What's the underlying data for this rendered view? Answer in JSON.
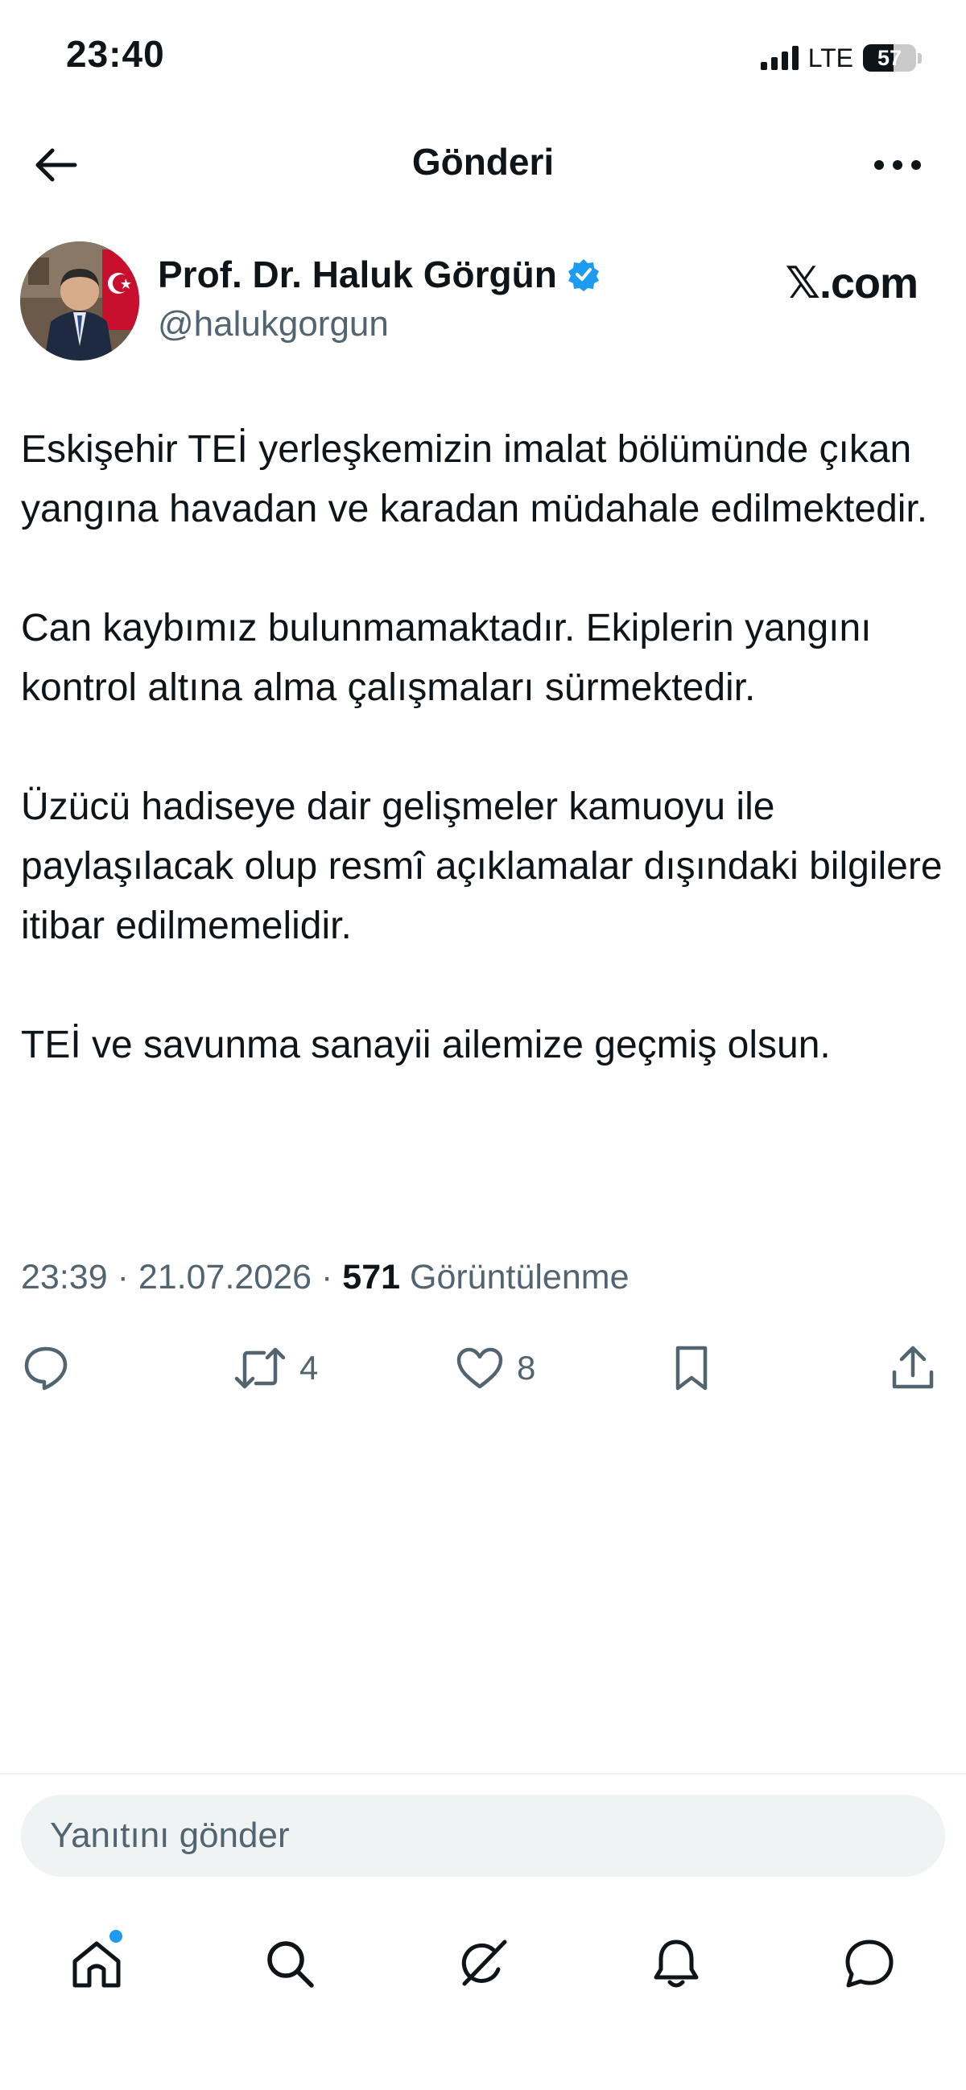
{
  "status_bar": {
    "time": "23:40",
    "network": "LTE",
    "battery": "57"
  },
  "header": {
    "title": "Gönderi"
  },
  "post": {
    "author_name": "Prof. Dr. Haluk Görgün",
    "author_handle": "@halukgorgun",
    "source": "𝕏.com",
    "paragraphs": [
      "Eskişehir TEİ yerleşkemizin imalat bölümünde çıkan yangına havadan ve karadan müdahale edilmektedir.",
      "Can kaybımız bulunmamaktadır. Ekiplerin yangını kontrol altına alma çalışmaları sürmektedir.",
      "Üzücü hadiseye dair gelişmeler kamuoyu ile paylaşılacak olup resmî açıklamalar dışındaki bilgilere itibar edilmemelidir.",
      "TEİ ve savunma sanayii ailemize geçmiş olsun."
    ],
    "time": "23:39",
    "date": "21.07.2026",
    "separator": "·",
    "views_count": "571",
    "views_label": "Görüntülenme"
  },
  "actions": {
    "reposts": "4",
    "likes": "8"
  },
  "reply": {
    "placeholder": "Yanıtını gönder"
  },
  "icons": {
    "back": "arrow-left-icon",
    "more": "more-horizontal-icon",
    "verified": "verified-badge-icon",
    "reply": "comment-icon",
    "repost": "repost-icon",
    "like": "heart-icon",
    "bookmark": "bookmark-icon",
    "share": "share-icon",
    "home": "home-icon",
    "search": "search-icon",
    "grok": "grok-icon",
    "notifications": "bell-icon",
    "messages": "message-icon"
  },
  "colors": {
    "accent": "#1d9bf0",
    "text": "#0f1419",
    "secondary": "#536471"
  }
}
